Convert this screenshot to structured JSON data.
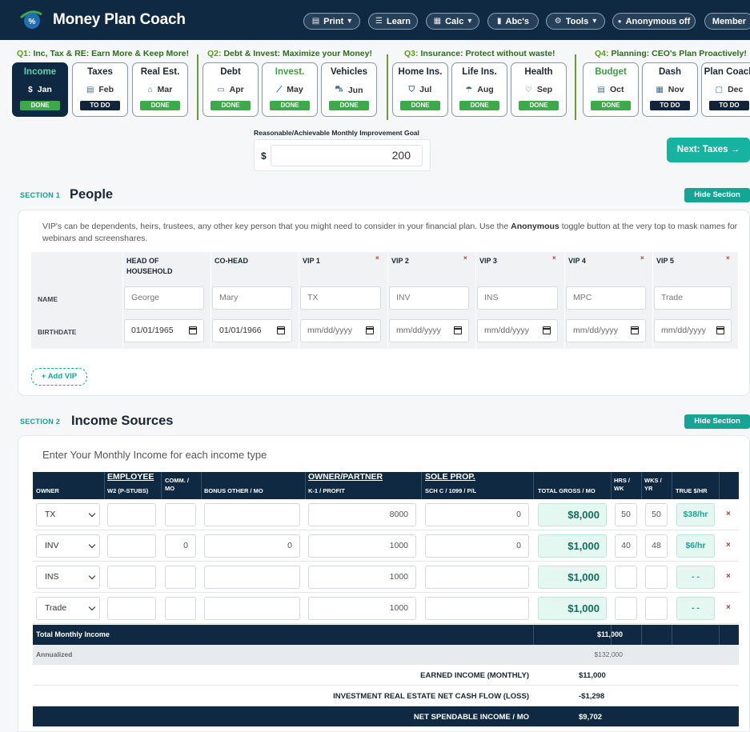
{
  "header": {
    "brand": "Money Plan Coach",
    "buttons": [
      {
        "label": "Print",
        "icon": "printer-icon",
        "dropdown": true
      },
      {
        "label": "Learn",
        "icon": "menu-icon",
        "dropdown": false
      },
      {
        "label": "Calc",
        "icon": "calculator-icon",
        "dropdown": true
      },
      {
        "label": "Abc's",
        "icon": "book-icon",
        "dropdown": false
      },
      {
        "label": "Tools",
        "icon": "gear-icon",
        "dropdown": true
      },
      {
        "label": "Anonymous off",
        "icon": "toggle-dot-icon",
        "dropdown": false
      },
      {
        "label": "Member",
        "icon": "",
        "dropdown": false
      }
    ]
  },
  "quarters": [
    {
      "label": "Q1:",
      "text": "Inc, Tax & RE: Earn More & Keep More!"
    },
    {
      "label": "Q2:",
      "text": "Debt & Invest: Maximize your Money!"
    },
    {
      "label": "Q3:",
      "text": "Insurance: Protect without waste!"
    },
    {
      "label": "Q4:",
      "text": "Planning: CEO's Plan Proactively!"
    }
  ],
  "steps": [
    {
      "title": "Income",
      "month": "Jan",
      "icon": "dollar-circle-icon",
      "status": "DONE",
      "state": "active"
    },
    {
      "title": "Taxes",
      "month": "Feb",
      "icon": "receipt-icon",
      "status": "TO DO",
      "state": "todo"
    },
    {
      "title": "Real Est.",
      "month": "Mar",
      "icon": "house-icon",
      "status": "DONE",
      "state": "done"
    },
    {
      "title": "Debt",
      "month": "Apr",
      "icon": "credit-card-icon",
      "status": "DONE",
      "state": "done"
    },
    {
      "title": "Invest.",
      "month": "May",
      "icon": "chart-line-icon",
      "status": "DONE",
      "state": "done-green"
    },
    {
      "title": "Vehicles",
      "month": "Jun",
      "icon": "car-icon",
      "status": "DONE",
      "state": "done"
    },
    {
      "title": "Home Ins.",
      "month": "Jul",
      "icon": "shield-icon",
      "status": "DONE",
      "state": "done"
    },
    {
      "title": "Life Ins.",
      "month": "Aug",
      "icon": "umbrella-icon",
      "status": "DONE",
      "state": "done"
    },
    {
      "title": "Health",
      "month": "Sep",
      "icon": "heart-icon",
      "status": "DONE",
      "state": "done"
    },
    {
      "title": "Budget",
      "month": "Oct",
      "icon": "clipboard-icon",
      "status": "DONE",
      "state": "done-green"
    },
    {
      "title": "Dash",
      "month": "Nov",
      "icon": "grid-icon",
      "status": "TO DO",
      "state": "todo"
    },
    {
      "title": "Plan Coach",
      "month": "Dec",
      "icon": "chat-icon",
      "status": "TO DO",
      "state": "todo"
    }
  ],
  "goal": {
    "label": "Reasonable/Achievable Monthly Improvement Goal",
    "currency": "$",
    "value": "200"
  },
  "next_button": "Next: Taxes →",
  "section1": {
    "num": "SECTION 1",
    "title": "People",
    "hide": "Hide Section",
    "desc_a": "VIP's can be dependents, heirs, trustees, any other key person that you might need to consider in your financial plan. Use the ",
    "desc_b": "Anonymous",
    "desc_c": " toggle button at the very top to mask names for webinars and screenshares.",
    "row_name": "NAME",
    "row_birth": "BIRTHDATE",
    "people": [
      {
        "header": "HEAD OF HOUSEHOLD",
        "name": "George",
        "birth": "01/01/1965",
        "removable": false
      },
      {
        "header": "CO-HEAD",
        "name": "Mary",
        "birth": "01/01/1966",
        "removable": false
      },
      {
        "header": "VIP 1",
        "name": "TX",
        "birth": "mm/dd/yyyy",
        "removable": true
      },
      {
        "header": "VIP 2",
        "name": "INV",
        "birth": "mm/dd/yyyy",
        "removable": true
      },
      {
        "header": "VIP 3",
        "name": "INS",
        "birth": "mm/dd/yyyy",
        "removable": true
      },
      {
        "header": "VIP 4",
        "name": "MPC",
        "birth": "mm/dd/yyyy",
        "removable": true
      },
      {
        "header": "VIP 5",
        "name": "Trade",
        "birth": "mm/dd/yyyy",
        "removable": true
      }
    ],
    "add_vip": "+ Add VIP",
    "remove_glyph": "×"
  },
  "section2": {
    "num": "SECTION 2",
    "title": "Income Sources",
    "hide": "Hide Section",
    "desc": "Enter Your Monthly Income for each income type",
    "headers": {
      "owner": "OWNER",
      "employee_top": "EMPLOYEE",
      "employee_bot": "W2 (P-STUBS)",
      "comm": "COMM. / MO",
      "bonus": "BONUS OTHER / MO",
      "owner_partner_top": "OWNER/PARTNER",
      "owner_partner_bot": "K-1 / PROFIT",
      "sole_top": "SOLE PROP.",
      "sole_bot": "SCH C / 1099 / P/L",
      "total_gross": "TOTAL GROSS / MO",
      "hrs": "HRS / WK",
      "wks": "WKS / YR",
      "true_hr": "TRUE $/HR"
    },
    "rows": [
      {
        "owner": "TX",
        "w2": "",
        "comm": "",
        "bonus": "",
        "k1": "8000",
        "sole": "0",
        "gross": "$8,000",
        "hrs": "50",
        "wks": "50",
        "true_hr": "$38/hr"
      },
      {
        "owner": "INV",
        "w2": "",
        "comm": "0",
        "bonus": "0",
        "k1": "1000",
        "sole": "0",
        "gross": "$1,000",
        "hrs": "40",
        "wks": "48",
        "true_hr": "$6/hr"
      },
      {
        "owner": "INS",
        "w2": "",
        "comm": "",
        "bonus": "",
        "k1": "1000",
        "sole": "",
        "gross": "$1,000",
        "hrs": "",
        "wks": "",
        "true_hr": "- -"
      },
      {
        "owner": "Trade",
        "w2": "",
        "comm": "",
        "bonus": "",
        "k1": "1000",
        "sole": "",
        "gross": "$1,000",
        "hrs": "",
        "wks": "",
        "true_hr": "- -"
      }
    ],
    "total_label": "Total Monthly Income",
    "total_value": "$11,000",
    "annual_label": "Annualized",
    "annual_value": "$132,000",
    "earned_label": "EARNED INCOME (MONTHLY)",
    "earned_value": "$11,000",
    "invest_label": "INVESTMENT REAL ESTATE NET CASH FLOW (LOSS)",
    "invest_value": "-$1,298",
    "net_label": "NET SPENDABLE INCOME / MO",
    "net_value": "$9,702",
    "remove_glyph": "×"
  },
  "colors": {
    "navy": "#0f2942",
    "teal": "#16b3a0",
    "green": "#3daa4a",
    "red": "#c0392b"
  }
}
